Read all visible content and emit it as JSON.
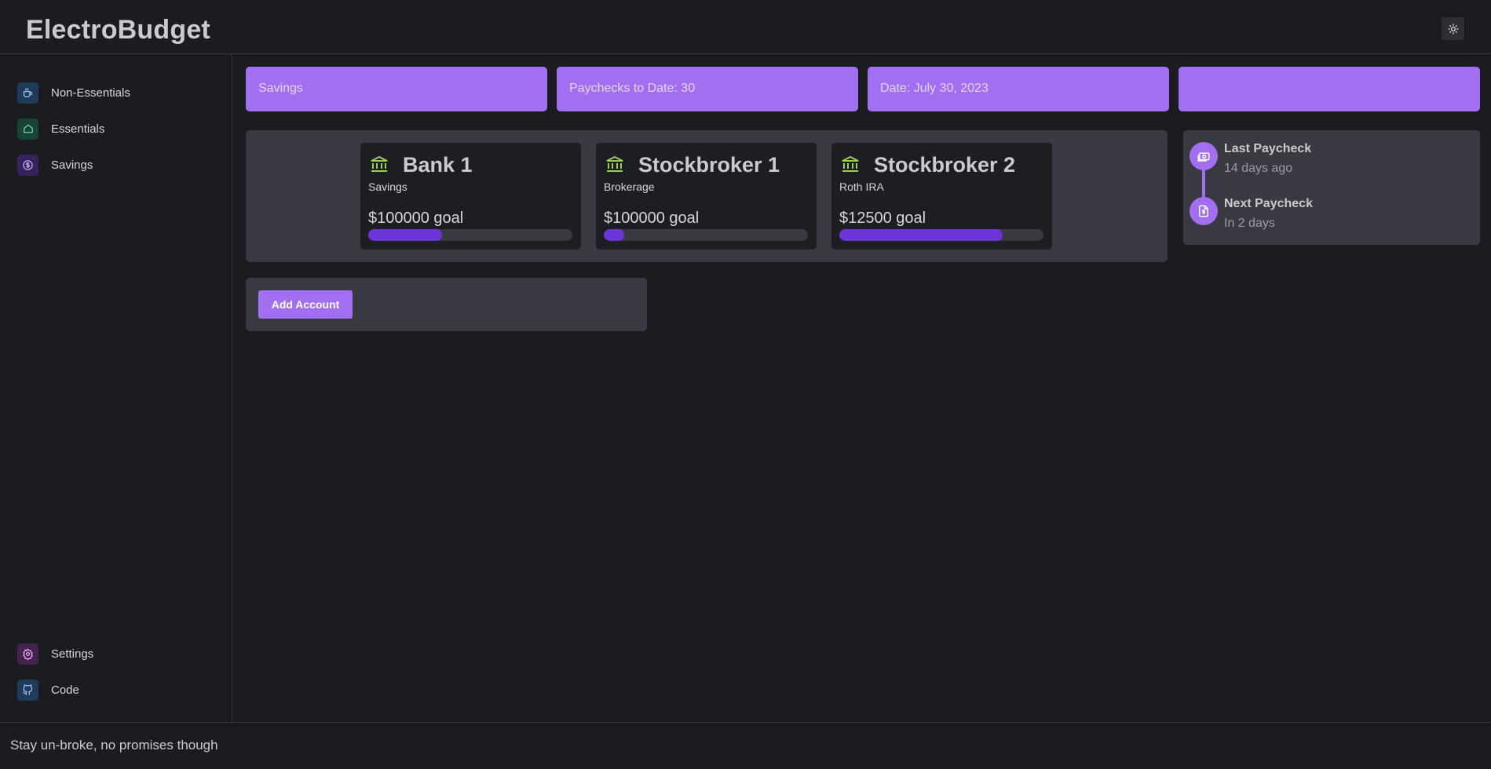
{
  "app": {
    "title": "ElectroBudget"
  },
  "sidebar": {
    "items": [
      {
        "label": "Non-Essentials",
        "icon": "coffee-cup-icon",
        "color": "#1f3b5a"
      },
      {
        "label": "Essentials",
        "icon": "home-icon",
        "color": "#184438"
      },
      {
        "label": "Savings",
        "icon": "dollar-circle-icon",
        "color": "#36235c"
      }
    ],
    "bottom_items": [
      {
        "label": "Settings",
        "icon": "gear-icon",
        "color": "#44234f"
      },
      {
        "label": "Code",
        "icon": "github-icon",
        "color": "#1f3b5a"
      }
    ]
  },
  "stats": [
    {
      "text": "Savings"
    },
    {
      "text": "Paychecks to Date: 30"
    },
    {
      "text": "Date: July 30, 2023"
    },
    {
      "text": ""
    }
  ],
  "accounts": [
    {
      "name": "Bank 1",
      "type": "Savings",
      "goal": "$100000 goal",
      "progress": 0.36
    },
    {
      "name": "Stockbroker 1",
      "type": "Brokerage",
      "goal": "$100000 goal",
      "progress": 0.1
    },
    {
      "name": "Stockbroker 2",
      "type": "Roth IRA",
      "goal": "$12500 goal",
      "progress": 0.8
    }
  ],
  "add_account_label": "Add Account",
  "timeline": [
    {
      "title": "Last Paycheck",
      "subtitle": "14 days ago",
      "icon": "cash-icon"
    },
    {
      "title": "Next Paycheck",
      "subtitle": "In 2 days",
      "icon": "invoice-dollar-icon"
    }
  ],
  "footer": {
    "text": "Stay un-broke, no promises though"
  },
  "colors": {
    "accent": "#a26ff3",
    "progress": "#6b35d9",
    "bank_icon": "#9bd24a"
  }
}
